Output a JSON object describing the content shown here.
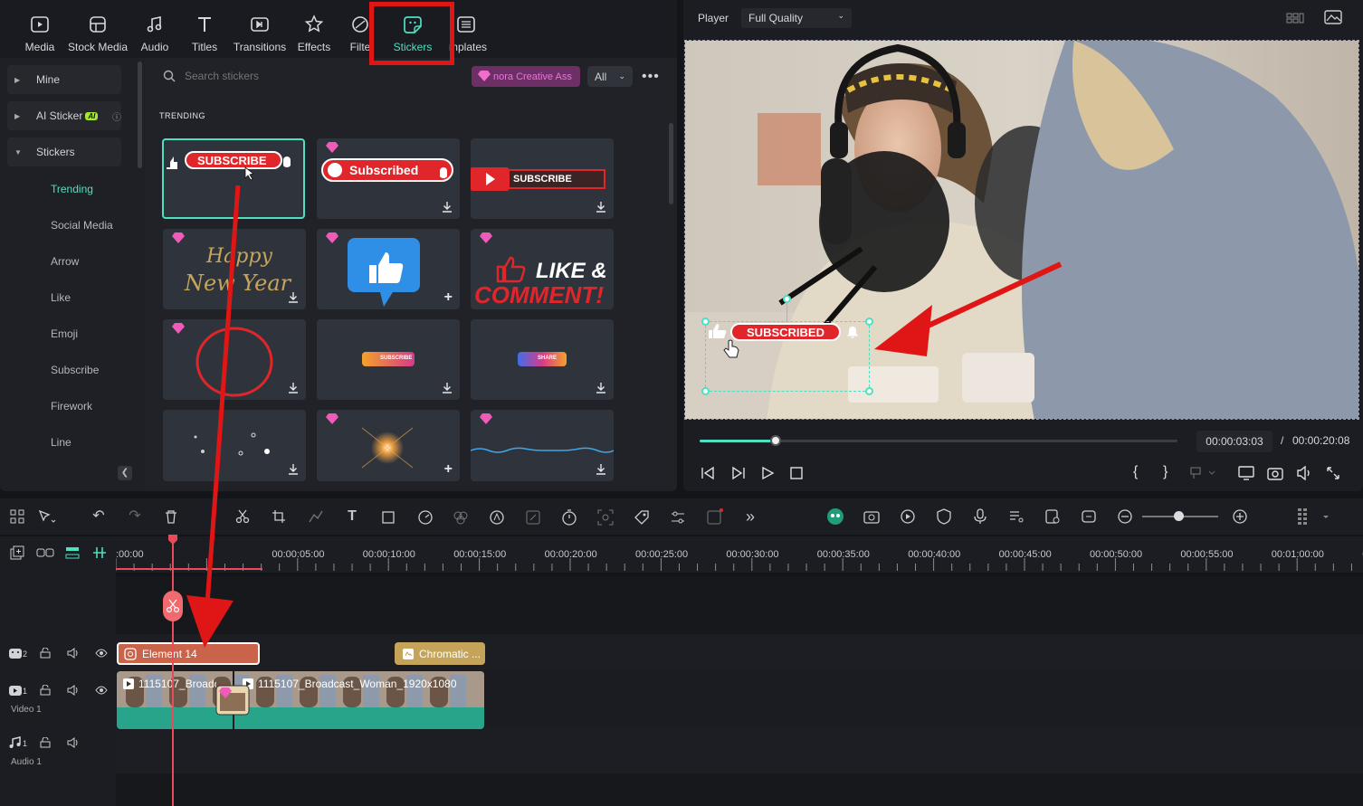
{
  "nav": {
    "tabs": [
      {
        "label": "Media",
        "icon": "media-icon"
      },
      {
        "label": "Stock Media",
        "icon": "stock-media-icon"
      },
      {
        "label": "Audio",
        "icon": "audio-icon"
      },
      {
        "label": "Titles",
        "icon": "titles-icon"
      },
      {
        "label": "Transitions",
        "icon": "transitions-icon"
      },
      {
        "label": "Effects",
        "icon": "effects-icon"
      },
      {
        "label": "Filte",
        "icon": "filters-icon"
      },
      {
        "label": "Stickers",
        "icon": "stickers-icon"
      },
      {
        "label": "mplates",
        "icon": "templates-icon"
      }
    ],
    "active": "Stickers",
    "accent": "#4ee0c0",
    "highlight_color": "#e01616"
  },
  "sidebar": {
    "mine": "Mine",
    "ai_sticker": "AI Sticker",
    "ai_badge": "AI",
    "stickers": "Stickers",
    "items": [
      "Trending",
      "Social Media",
      "Arrow",
      "Like",
      "Emoji",
      "Subscribe",
      "Firework",
      "Line"
    ]
  },
  "search": {
    "placeholder": "Search stickers"
  },
  "creative_button": "nora Creative Ass",
  "filter": {
    "selected": "All"
  },
  "section": "TRENDING",
  "stickers": {
    "subscribe": "SUBSCRIBE",
    "subscribed": "Subscribed",
    "subscribe_yt": "SUBSCRIBE",
    "happy": "Happy",
    "new_year": "New Year",
    "like": "LIKE &",
    "comment": "COMMENT!",
    "small_subscribe": "SUBSCRIBE",
    "share": "SHARE"
  },
  "player": {
    "label": "Player",
    "quality": "Full Quality",
    "sticker_text": "SUBSCRIBED",
    "current_time": "00:00:03:03",
    "separator": "/",
    "total_time": "00:00:20:08",
    "progress": 0.16
  },
  "timeline": {
    "ticks": [
      ":00:00",
      "00:00:05:00",
      "00:00:10:00",
      "00:00:15:00",
      "00:00:20:00",
      "00:00:25:00",
      "00:00:30:00",
      "00:00:35:00",
      "00:00:40:00",
      "00:00:45:00",
      "00:00:50:00",
      "00:00:55:00",
      "00:01:00:00",
      "00:01:05:00"
    ],
    "tracks": {
      "track2_num": "2",
      "video_num": "1",
      "video_label": "Video 1",
      "audio_num": "1",
      "audio_label": "Audio 1"
    },
    "clips": {
      "element": "Element 14",
      "chromatic": "Chromatic ...",
      "video_a": "1115107_Broadc",
      "video_b": "1115107_Broadcast_Woman_1920x1080"
    }
  }
}
